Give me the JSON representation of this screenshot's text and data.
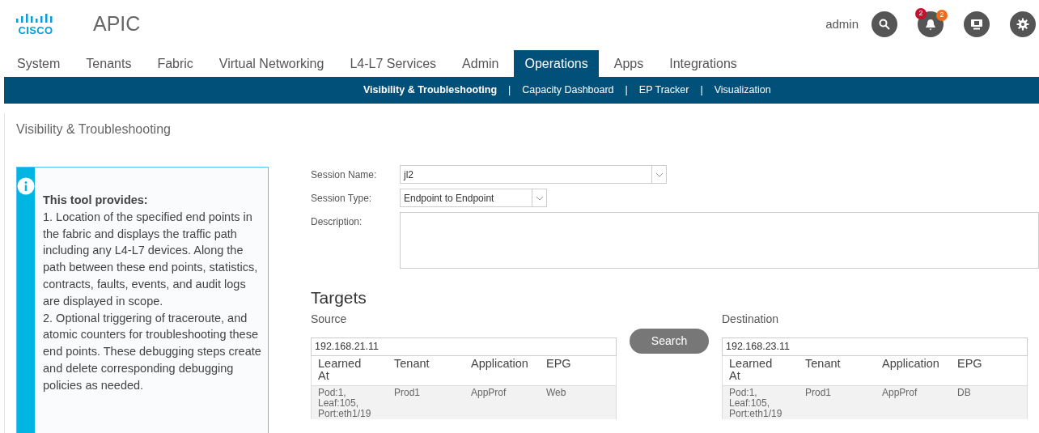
{
  "header": {
    "logo_text": "CISCO",
    "app_title": "APIC",
    "user": "admin",
    "notifications": [
      {
        "count": "2",
        "color": "#c8102e"
      },
      {
        "count": "2",
        "color": "#f26b1d"
      }
    ]
  },
  "tabs": [
    {
      "label": "System",
      "selected": false
    },
    {
      "label": "Tenants",
      "selected": false
    },
    {
      "label": "Fabric",
      "selected": false
    },
    {
      "label": "Virtual Networking",
      "selected": false
    },
    {
      "label": "L4-L7 Services",
      "selected": false
    },
    {
      "label": "Admin",
      "selected": false
    },
    {
      "label": "Operations",
      "selected": true
    },
    {
      "label": "Apps",
      "selected": false
    },
    {
      "label": "Integrations",
      "selected": false
    }
  ],
  "subnav": {
    "separator": "|",
    "items": [
      {
        "label": "Visibility & Troubleshooting",
        "selected": true
      },
      {
        "label": "Capacity Dashboard",
        "selected": false
      },
      {
        "label": "EP Tracker",
        "selected": false
      },
      {
        "label": "Visualization",
        "selected": false
      }
    ]
  },
  "page_title": "Visibility & Troubleshooting",
  "info": {
    "title": "This tool provides:",
    "body": "1. Location of the specified end points in the fabric and displays the traffic path including any L4-L7 devices. Along the path between these end points, statistics, contracts, faults, events, and audit logs are displayed in scope.\n2. Optional triggering of traceroute, and atomic counters for troubleshooting these end points. These debugging steps create and delete corresponding debugging policies as needed."
  },
  "form": [
    {
      "kind": "select",
      "label": "Session Name:",
      "value": "jl2"
    },
    {
      "kind": "select-short",
      "label": "Session Type:",
      "value": "Endpoint to Endpoint"
    },
    {
      "kind": "textarea",
      "label": "Description:"
    }
  ],
  "targets": {
    "heading": "Targets",
    "search_button": "Search",
    "source": {
      "label": "Source",
      "value": "192.168.21.11",
      "columns": [
        "Learned At",
        "Tenant",
        "Application",
        "EPG"
      ],
      "rows": [
        [
          "Pod:1, Leaf:105, Port:eth1/19",
          "Prod1",
          "AppProf",
          "Web"
        ]
      ]
    },
    "destination": {
      "label": "Destination",
      "value": "192.168.23.11",
      "columns": [
        "Learned At",
        "Tenant",
        "Application",
        "EPG"
      ],
      "rows": [
        [
          "Pod:1, Leaf:105, Port:eth1/19",
          "Prod1",
          "AppProf",
          "DB"
        ]
      ]
    }
  }
}
